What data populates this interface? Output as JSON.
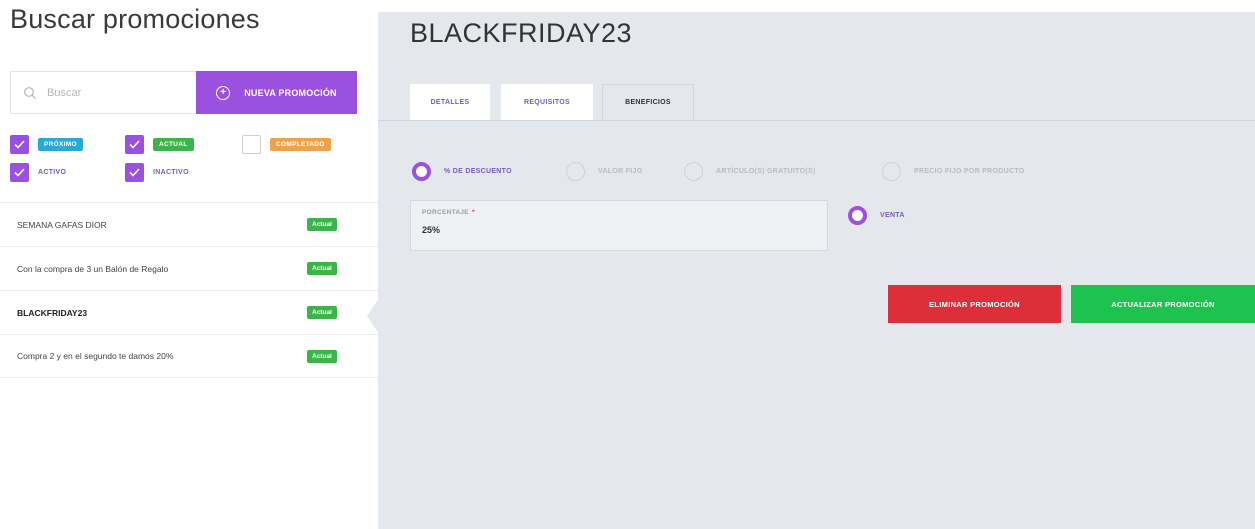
{
  "left": {
    "title": "Buscar promociones",
    "search": {
      "placeholder": "Buscar",
      "icon": "search-icon"
    },
    "new_button": "NUEVA PROMOCIÓN",
    "filters": [
      {
        "label": "PRÓXIMO",
        "checked": true,
        "style": "tag",
        "color": "#29a9d9"
      },
      {
        "label": "ACTUAL",
        "checked": true,
        "style": "tag",
        "color": "#3bb54a"
      },
      {
        "label": "COMPLETADO",
        "checked": false,
        "style": "tag",
        "color": "#f0a24b"
      },
      {
        "label": "ACTIVO",
        "checked": true,
        "style": "text"
      },
      {
        "label": "INACTIVO",
        "checked": true,
        "style": "text"
      }
    ],
    "promotions": [
      {
        "name": "SEMANA GAFAS DIOR",
        "status": "Actual",
        "selected": false
      },
      {
        "name": "Con la compra de 3 un Balón de Regalo",
        "status": "Actual",
        "selected": false
      },
      {
        "name": "BLACKFRIDAY23",
        "status": "Actual",
        "selected": true
      },
      {
        "name": "Compra 2 y en el segundo te damos 20%",
        "status": "Actual",
        "selected": false
      }
    ]
  },
  "detail": {
    "title": "BLACKFRIDAY23",
    "tabs": [
      {
        "label": "DETALLES",
        "active": false
      },
      {
        "label": "REQUISITOS",
        "active": false
      },
      {
        "label": "BENEFICIOS",
        "active": true
      }
    ],
    "benefit_types": [
      {
        "label": "% DE DESCUENTO",
        "selected": true
      },
      {
        "label": "VALOR FIJO",
        "selected": false
      },
      {
        "label": "ARTÍCULO(S) GRATUITO(S)",
        "selected": false
      },
      {
        "label": "PRECIO FIJO POR PRODUCTO",
        "selected": false
      }
    ],
    "percentage_field": {
      "label": "PORCENTAJE",
      "required_mark": "*",
      "value": "25%"
    },
    "venta_option": {
      "label": "VENTA",
      "selected": true
    },
    "delete_button": "ELIMINAR PROMOCIÓN",
    "update_button": "ACTUALIZAR PROMOCIÓN"
  },
  "colors": {
    "accent": "#9b51e0",
    "panel_bg": "#e4e7eb",
    "status_green": "#3bb54a",
    "danger": "#dc2f3a",
    "success": "#1ec24e"
  }
}
